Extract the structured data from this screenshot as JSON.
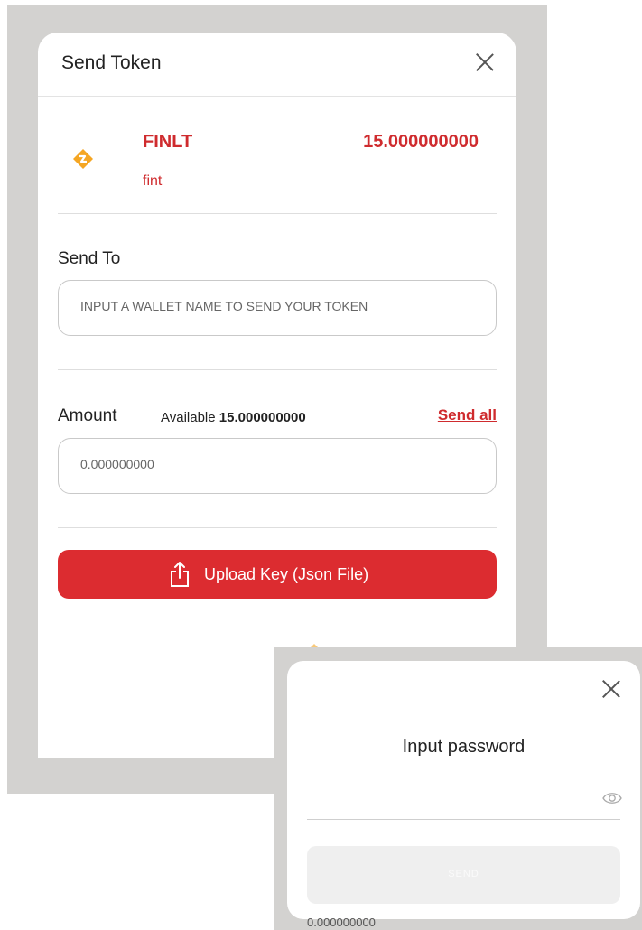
{
  "send_token_modal": {
    "title": "Send Token",
    "token": {
      "name": "FINLT",
      "symbol": "fint",
      "balance": "15.000000000",
      "icon": "finlt-token-icon",
      "accent_color": "#F5A623"
    },
    "send_to": {
      "label": "Send To",
      "placeholder": "INPUT A WALLET NAME TO SEND YOUR TOKEN"
    },
    "amount": {
      "label": "Amount",
      "available_prefix": "Available",
      "available_value": "15.000000000",
      "send_all": "Send all",
      "value": "0.000000000"
    },
    "upload_button": {
      "label": "Upload Key (Json File)",
      "icon": "upload-icon",
      "color": "#DC2C30"
    }
  },
  "password_modal": {
    "title": "Input password",
    "send_label": "SEND",
    "toggle_icon": "eye-icon"
  },
  "background": {
    "stray_text": "0.000000000"
  },
  "colors": {
    "brand_red": "#CF2B2E",
    "overlay_gray": "#D3D2D0"
  }
}
